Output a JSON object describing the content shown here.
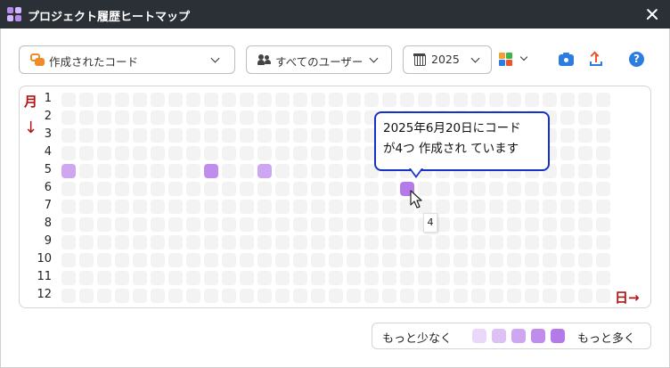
{
  "window": {
    "title": "プロジェクト履歴ヒートマップ"
  },
  "toolbar": {
    "type_dropdown": "作成されたコード",
    "user_dropdown": "すべてのユーザー",
    "year_dropdown": "2025"
  },
  "heatmap": {
    "month_axis_label": "月",
    "month_arrow": "↓",
    "day_axis_label": "日→",
    "row_labels": [
      "1",
      "2",
      "3",
      "4",
      "5",
      "6",
      "7",
      "8",
      "9",
      "10",
      "11",
      "12"
    ],
    "columns_per_row": 31,
    "highlighted_cells": [
      {
        "month": 5,
        "day": 1,
        "count": 2
      },
      {
        "month": 5,
        "day": 9,
        "count": 3
      },
      {
        "month": 5,
        "day": 12,
        "count": 2
      },
      {
        "month": 6,
        "day": 20,
        "count": 4
      }
    ]
  },
  "callout": {
    "line1": "2025年6月20日にコード",
    "line2": "が4つ 作成され ています"
  },
  "tooltip_value": "4",
  "legend": {
    "less_label": "もっと少なく",
    "more_label": "もっと多く",
    "colors": [
      "#ead8fb",
      "#dcc0f6",
      "#cfa6f2",
      "#c08cee",
      "#b57ae9"
    ]
  },
  "colors": {
    "titlebar": "#2b2f36",
    "accent_red": "#b01515",
    "callout_border": "#1432c8",
    "empty_cell": "#f3f3f3",
    "icon_blue": "#2b7de1",
    "icon_orange": "#f08a2a"
  }
}
